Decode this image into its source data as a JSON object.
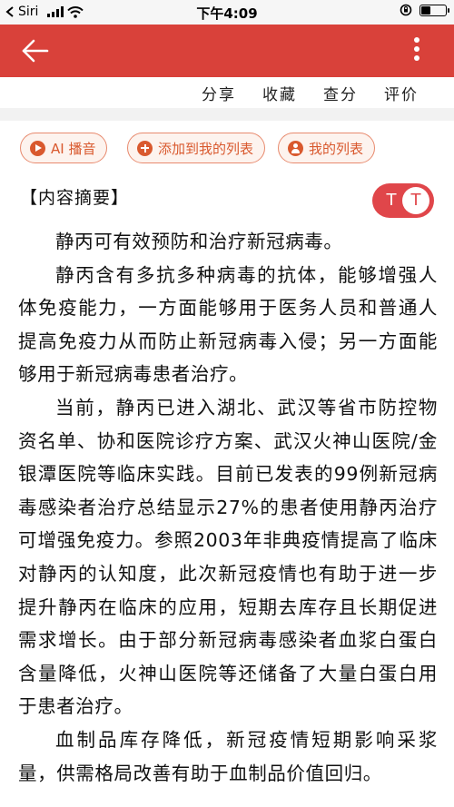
{
  "status_bar": {
    "carrier": "Siri",
    "time": "下午4:09"
  },
  "actions": {
    "share": "分享",
    "favorite": "收藏",
    "check": "查分",
    "review": "评价"
  },
  "pills": {
    "ai_play": "AI 播音",
    "add_to_list": "添加到我的列表",
    "my_list": "我的列表"
  },
  "summary": {
    "heading": "【内容摘要】",
    "toggle_left": "T",
    "toggle_right": "T"
  },
  "article": {
    "paragraphs": [
      "静丙可有效预防和治疗新冠病毒。",
      "静丙含有多抗多种病毒的抗体，能够增强人体免疫能力，一方面能够用于医务人员和普通人提高免疫力从而防止新冠病毒入侵；另一方面能够用于新冠病毒患者治疗。",
      "当前，静丙已进入湖北、武汉等省市防控物资名单、协和医院诊疗方案、武汉火神山医院/金银潭医院等临床实践。目前已发表的99例新冠病毒感染者治疗总结显示27%的患者使用静丙治疗可增强免疫力。参照2003年非典疫情提高了临床对静丙的认知度，此次新冠疫情也有助于进一步提升静丙在临床的应用，短期去库存且长期促进需求增长。由于部分新冠病毒感染者血浆白蛋白含量降低，火神山医院等还储备了大量白蛋白用于患者治疗。",
      "血制品库存降低，新冠疫情短期影响采浆量，供需格局改善有助于血制品价值回归。"
    ]
  },
  "colors": {
    "nav_red": "#d9413a",
    "pill_orange": "#d9592e",
    "toggle_red": "#e0464a"
  }
}
